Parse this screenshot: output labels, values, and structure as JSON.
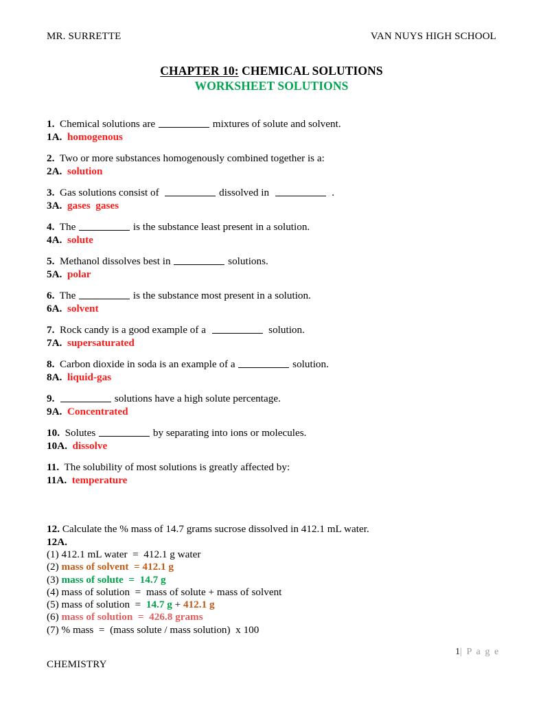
{
  "header": {
    "left": "MR. SURRETTE",
    "right": "VAN NUYS HIGH SCHOOL"
  },
  "title": {
    "underlined": "CHAPTER 10:",
    "rest": " CHEMICAL SOLUTIONS",
    "subtitle": "WORKSHEET SOLUTIONS"
  },
  "colors": {
    "answer_red": "#FF1A1A",
    "title_green": "#00A550",
    "calc_green": "#00A04A",
    "calc_orange": "#C05A17",
    "calc_salmon": "#E05B5B",
    "page_gray": "#808080",
    "text_black": "#000000"
  },
  "questions": [
    {
      "num": "1.",
      "pre": "  Chemical solutions are ",
      "mid": "",
      "post": " mixtures of solute and solvent.",
      "blanks": 1,
      "alabel": "1A.",
      "answer": "homogenous"
    },
    {
      "num": "2.",
      "pre": "  Two or more substances homogenously combined together is a:",
      "mid": "",
      "post": "",
      "blanks": 0,
      "alabel": "2A.",
      "answer": "solution"
    },
    {
      "num": "3.",
      "pre": "  Gas solutions consist of  ",
      "mid": " dissolved in  ",
      "post": "  .",
      "blanks": 2,
      "alabel": "3A.",
      "answer": "gases  gases"
    },
    {
      "num": "4.",
      "pre": "  The ",
      "mid": "",
      "post": " is the substance least present in a solution.",
      "blanks": 1,
      "alabel": "4A.",
      "answer": "solute"
    },
    {
      "num": "5.",
      "pre": "  Methanol dissolves best in ",
      "mid": "",
      "post": " solutions.",
      "blanks": 1,
      "alabel": "5A.",
      "answer": "polar"
    },
    {
      "num": "6.",
      "pre": "  The ",
      "mid": "",
      "post": " is the substance most present in a solution.",
      "blanks": 1,
      "alabel": "6A.",
      "answer": "solvent"
    },
    {
      "num": "7.",
      "pre": "  Rock candy is a good example of a  ",
      "mid": "",
      "post": "  solution.",
      "blanks": 1,
      "alabel": "7A.",
      "answer": "supersaturated"
    },
    {
      "num": "8.",
      "pre": "  Carbon dioxide in soda is an example of a ",
      "mid": "",
      "post": " solution.",
      "blanks": 1,
      "alabel": "8A.",
      "answer": "liquid-gas"
    },
    {
      "num": "9.",
      "pre": "  ",
      "mid": "",
      "post": " solutions have a high solute percentage.",
      "blanks": 1,
      "alabel": "9A.",
      "answer": "Concentrated"
    },
    {
      "num": "10.",
      "pre": "  Solutes ",
      "mid": "",
      "post": " by separating into ions or molecules.",
      "blanks": 1,
      "alabel": "10A.",
      "answer": "dissolve"
    },
    {
      "num": "11.",
      "pre": "  The solubility of most solutions is greatly affected by:",
      "mid": "",
      "post": "",
      "blanks": 0,
      "alabel": "11A.",
      "answer": "temperature"
    }
  ],
  "worked": {
    "num": "12.",
    "question": "  Calculate the % mass of 14.7 grams sucrose dissolved in 412.1 mL water.",
    "alabel": "12A.",
    "steps": [
      {
        "idx": "(1)",
        "segments": [
          {
            "text": " 412.1 mL water  =  412.1 g water",
            "color": "text_black",
            "bold": false
          }
        ]
      },
      {
        "idx": "(2)",
        "segments": [
          {
            "text": " mass of solvent  = 412.1 g",
            "color": "calc_orange",
            "bold": true
          }
        ]
      },
      {
        "idx": "(3)",
        "segments": [
          {
            "text": " mass of solute  =  14.7 g",
            "color": "calc_green",
            "bold": true
          }
        ]
      },
      {
        "idx": "(4)",
        "segments": [
          {
            "text": " mass of solution  =  mass of solute + mass of solvent",
            "color": "text_black",
            "bold": false
          }
        ]
      },
      {
        "idx": "(5)",
        "segments": [
          {
            "text": " mass of solution  =  ",
            "color": "text_black",
            "bold": false
          },
          {
            "text": "14.7 g",
            "color": "calc_green",
            "bold": true
          },
          {
            "text": " + ",
            "color": "text_black",
            "bold": false
          },
          {
            "text": "412.1 g",
            "color": "calc_orange",
            "bold": true
          }
        ]
      },
      {
        "idx": "(6)",
        "segments": [
          {
            "text": " mass of solution  =  426.8 grams",
            "color": "calc_salmon",
            "bold": true
          }
        ]
      },
      {
        "idx": "(7)",
        "segments": [
          {
            "text": " % mass  =  (mass solute / mass solution)  x 100",
            "color": "text_black",
            "bold": false
          }
        ]
      }
    ]
  },
  "footer": {
    "page_number": "1",
    "page_label": "| P a g e",
    "subject": "CHEMISTRY"
  }
}
